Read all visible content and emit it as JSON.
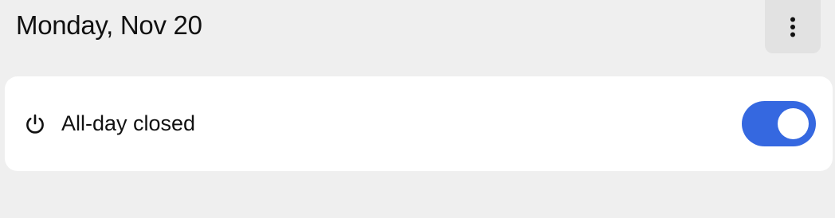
{
  "header": {
    "date_title": "Monday, Nov 20",
    "more_icon": "more-vertical-icon"
  },
  "card": {
    "icon": "power-icon",
    "label": "All-day closed",
    "toggle": {
      "on": true,
      "color": "#3568e0"
    }
  },
  "colors": {
    "background": "#efefef",
    "card": "#ffffff",
    "accent": "#3568e0"
  }
}
